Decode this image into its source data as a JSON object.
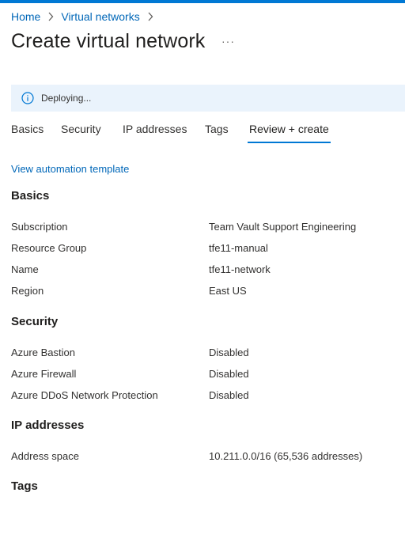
{
  "colors": {
    "accent": "#0078d4",
    "link": "#0067b8",
    "banner_bg": "#eaf3fc"
  },
  "breadcrumb": {
    "items": [
      "Home",
      "Virtual networks"
    ]
  },
  "header": {
    "title": "Create virtual network",
    "more_icon": "ellipsis-icon"
  },
  "banner": {
    "icon": "info-icon",
    "text": "Deploying..."
  },
  "tabs": [
    {
      "label": "Basics"
    },
    {
      "label": "Security"
    },
    {
      "label": "IP addresses"
    },
    {
      "label": "Tags"
    },
    {
      "label": "Review + create",
      "selected": true
    }
  ],
  "automation_link": "View automation template",
  "sections": {
    "basics": {
      "title": "Basics",
      "rows": [
        {
          "label": "Subscription",
          "value": "Team Vault Support Engineering"
        },
        {
          "label": "Resource Group",
          "value": "tfe11-manual"
        },
        {
          "label": "Name",
          "value": "tfe11-network"
        },
        {
          "label": "Region",
          "value": "East US"
        }
      ]
    },
    "security": {
      "title": "Security",
      "rows": [
        {
          "label": "Azure Bastion",
          "value": "Disabled"
        },
        {
          "label": "Azure Firewall",
          "value": "Disabled"
        },
        {
          "label": "Azure DDoS Network Protection",
          "value": "Disabled"
        }
      ]
    },
    "ip": {
      "title": "IP addresses",
      "rows": [
        {
          "label": "Address space",
          "value": "10.211.0.0/16 (65,536 addresses)"
        }
      ]
    },
    "tags": {
      "title": "Tags"
    }
  }
}
